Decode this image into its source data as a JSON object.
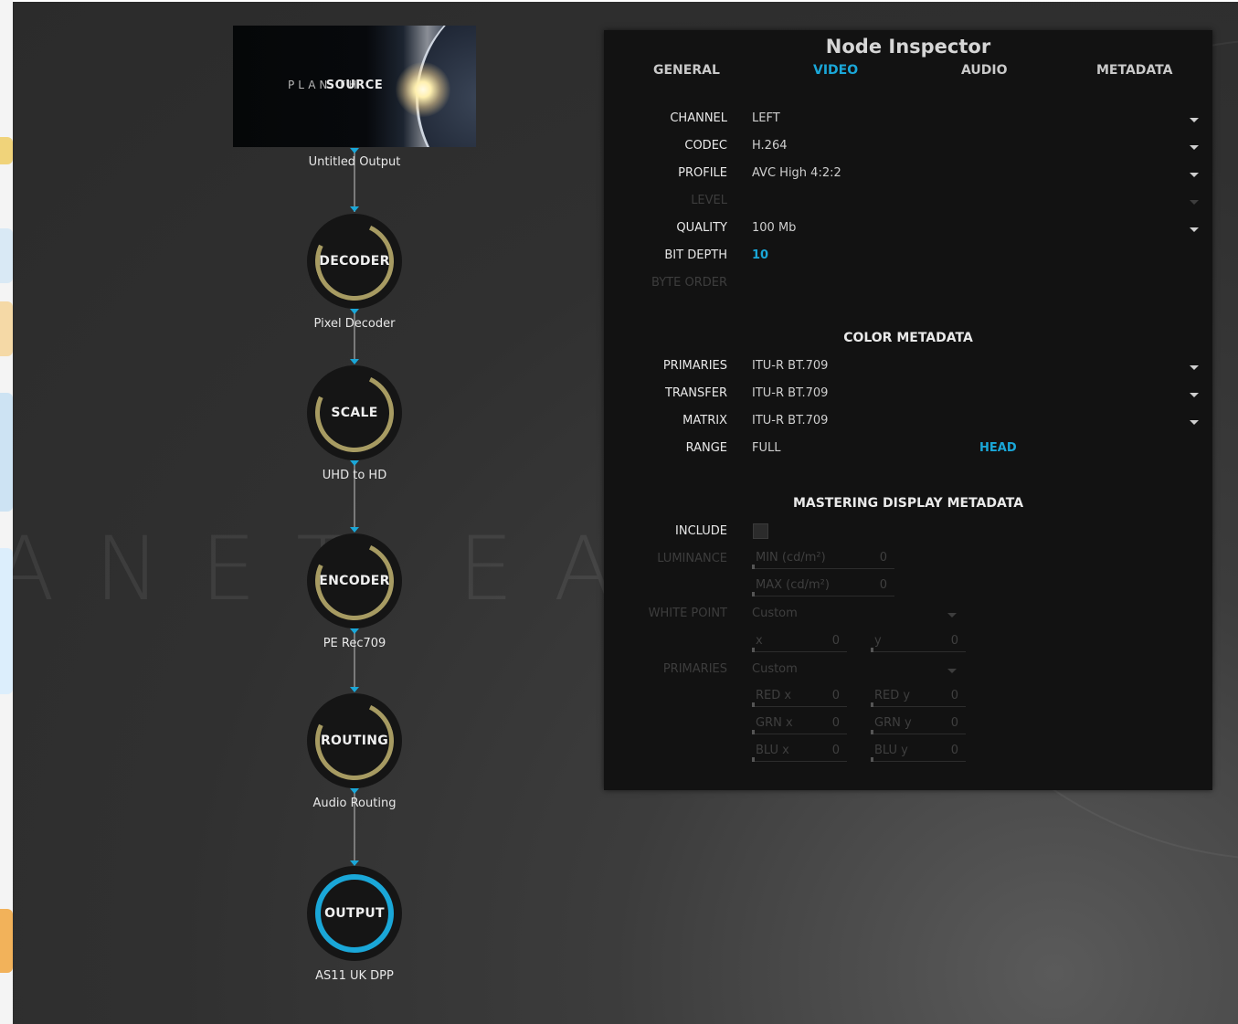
{
  "graph": {
    "source": {
      "thumb_title": "SOURCE",
      "thumb_ghost": "PLAN     TH",
      "label": "Untitled Output"
    },
    "nodes": [
      {
        "key": "decoder",
        "title": "DECODER",
        "label": "Pixel Decoder"
      },
      {
        "key": "scale",
        "title": "SCALE",
        "label": "UHD to HD"
      },
      {
        "key": "encoder",
        "title": "ENCODER",
        "label": "PE Rec709"
      },
      {
        "key": "routing",
        "title": "ROUTING",
        "label": "Audio Routing"
      },
      {
        "key": "output",
        "title": "OUTPUT",
        "label": "AS11 UK DPP"
      }
    ],
    "background_word": "ANET EART"
  },
  "inspector": {
    "title": "Node Inspector",
    "tabs": [
      "GENERAL",
      "VIDEO",
      "AUDIO",
      "METADATA"
    ],
    "active_tab": "VIDEO",
    "video": {
      "channel": {
        "label": "CHANNEL",
        "value": "LEFT"
      },
      "codec": {
        "label": "CODEC",
        "value": "H.264"
      },
      "profile": {
        "label": "PROFILE",
        "value": "AVC High 4:2:2"
      },
      "level": {
        "label": "LEVEL",
        "value": ""
      },
      "quality": {
        "label": "QUALITY",
        "value": "100 Mb"
      },
      "bit_depth": {
        "label": "BIT DEPTH",
        "value": "10"
      },
      "byte_order": {
        "label": "BYTE ORDER",
        "value": ""
      }
    },
    "color_metadata": {
      "title": "COLOR METADATA",
      "primaries": {
        "label": "PRIMARIES",
        "value": "ITU-R BT.709"
      },
      "transfer": {
        "label": "TRANSFER",
        "value": "ITU-R BT.709"
      },
      "matrix": {
        "label": "MATRIX",
        "value": "ITU-R BT.709"
      },
      "range": {
        "label": "RANGE",
        "value": "FULL",
        "link": "HEAD"
      }
    },
    "mastering": {
      "title": "MASTERING DISPLAY METADATA",
      "include_label": "INCLUDE",
      "include_checked": false,
      "luminance_label": "LUMINANCE",
      "min": {
        "label": "MIN (cd/m²)",
        "value": "0"
      },
      "max": {
        "label": "MAX (cd/m²)",
        "value": "0"
      },
      "white_point_label": "WHITE POINT",
      "white_point_value": "Custom",
      "wp_x": {
        "label": "x",
        "value": "0"
      },
      "wp_y": {
        "label": "y",
        "value": "0"
      },
      "primaries_label": "PRIMARIES",
      "primaries_value": "Custom",
      "red_x": {
        "label": "RED x",
        "value": "0"
      },
      "red_y": {
        "label": "RED y",
        "value": "0"
      },
      "grn_x": {
        "label": "GRN x",
        "value": "0"
      },
      "grn_y": {
        "label": "GRN y",
        "value": "0"
      },
      "blu_x": {
        "label": "BLU x",
        "value": "0"
      },
      "blu_y": {
        "label": "BLU y",
        "value": "0"
      }
    }
  },
  "colors": {
    "accent": "#1aa7d8",
    "ring": "#a79b62",
    "panel": "#121212"
  },
  "icons": {
    "dropdown": "caret-down-icon",
    "port": "port-arrow-icon"
  }
}
